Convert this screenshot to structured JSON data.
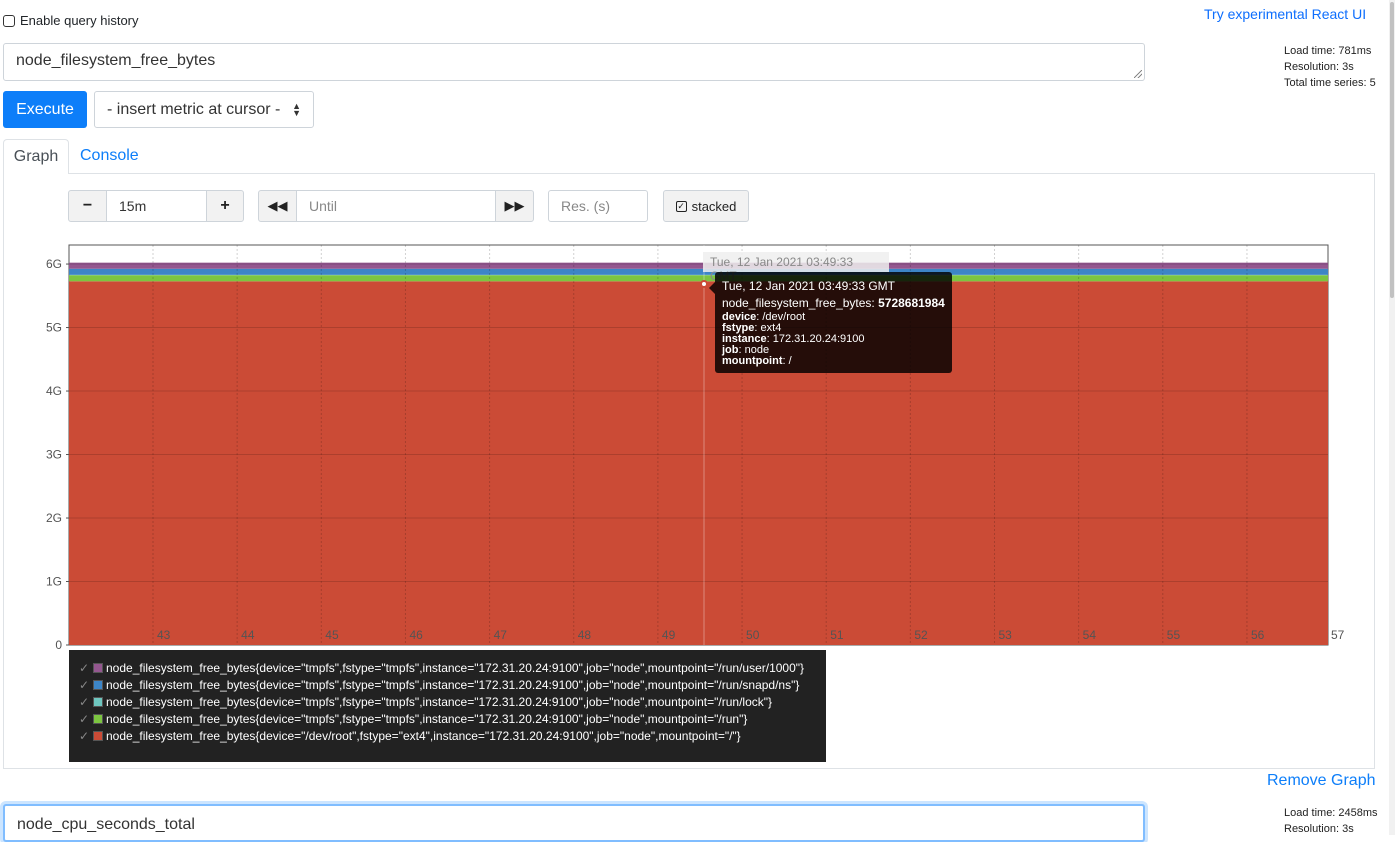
{
  "top": {
    "history_label": "Enable query history",
    "react_link": "Try experimental React UI"
  },
  "panel1": {
    "expression": "node_filesystem_free_bytes",
    "stats": {
      "load_time": "Load time: 781ms",
      "resolution": "Resolution: 3s",
      "total_series": "Total time series: 5"
    },
    "execute_label": "Execute",
    "metric_select": "- insert metric at cursor -",
    "tabs": {
      "graph": "Graph",
      "console": "Console"
    },
    "controls": {
      "minus": "−",
      "range": "15m",
      "plus": "+",
      "back": "◀◀",
      "until_placeholder": "Until",
      "forward": "▶▶",
      "res_placeholder": "Res. (s)",
      "stacked_label": "stacked"
    },
    "hover_label": "Tue, 12 Jan 2021 03:49:33 GMT",
    "tooltip": {
      "time": "Tue, 12 Jan 2021 03:49:33 GMT",
      "metric": "node_filesystem_free_bytes: ",
      "value": "5728681984",
      "labels": [
        {
          "k": "device",
          "v": ": /dev/root"
        },
        {
          "k": "fstype",
          "v": ": ext4"
        },
        {
          "k": "instance",
          "v": ": 172.31.20.24:9100"
        },
        {
          "k": "job",
          "v": ": node"
        },
        {
          "k": "mountpoint",
          "v": ": /"
        }
      ]
    },
    "legend": [
      {
        "label": "node_filesystem_free_bytes{device=\"tmpfs\",fstype=\"tmpfs\",instance=\"172.31.20.24:9100\",job=\"node\",mountpoint=\"/run/user/1000\"}",
        "color": "#94578f"
      },
      {
        "label": "node_filesystem_free_bytes{device=\"tmpfs\",fstype=\"tmpfs\",instance=\"172.31.20.24:9100\",job=\"node\",mountpoint=\"/run/snapd/ns\"}",
        "color": "#3d85c6"
      },
      {
        "label": "node_filesystem_free_bytes{device=\"tmpfs\",fstype=\"tmpfs\",instance=\"172.31.20.24:9100\",job=\"node\",mountpoint=\"/run/lock\"}",
        "color": "#6fc7c0"
      },
      {
        "label": "node_filesystem_free_bytes{device=\"tmpfs\",fstype=\"tmpfs\",instance=\"172.31.20.24:9100\",job=\"node\",mountpoint=\"/run\"}",
        "color": "#7cc540"
      },
      {
        "label": "node_filesystem_free_bytes{device=\"/dev/root\",fstype=\"ext4\",instance=\"172.31.20.24:9100\",job=\"node\",mountpoint=\"/\"}",
        "color": "#cb4b36"
      }
    ],
    "remove_graph": "Remove Graph"
  },
  "panel2": {
    "expression": "node_cpu_seconds_total",
    "stats": {
      "load_time": "Load time: 2458ms",
      "resolution": "Resolution: 3s"
    }
  },
  "chart_data": {
    "type": "area",
    "stacked": true,
    "x": [
      "43",
      "44",
      "45",
      "46",
      "47",
      "48",
      "49",
      "50",
      "51",
      "52",
      "53",
      "54",
      "55",
      "56",
      "57"
    ],
    "y_ticks": [
      "0",
      "1G",
      "2G",
      "3G",
      "4G",
      "5G",
      "6G"
    ],
    "ylim": [
      0,
      6300000000
    ],
    "grid": true,
    "series": [
      {
        "name": "node_filesystem_free_bytes{device=\"/dev/root\",fstype=\"ext4\",instance=\"172.31.20.24:9100\",job=\"node\",mountpoint=\"/\"}",
        "color": "#cb4b36",
        "value": 5728681984
      },
      {
        "name": "node_filesystem_free_bytes{device=\"tmpfs\",fstype=\"tmpfs\",instance=\"172.31.20.24:9100\",job=\"node\",mountpoint=\"/run\"}",
        "color": "#7cc540",
        "value": 96000000
      },
      {
        "name": "node_filesystem_free_bytes{device=\"tmpfs\",fstype=\"tmpfs\",instance=\"172.31.20.24:9100\",job=\"node\",mountpoint=\"/run/lock\"}",
        "color": "#6fc7c0",
        "value": 5200000
      },
      {
        "name": "node_filesystem_free_bytes{device=\"tmpfs\",fstype=\"tmpfs\",instance=\"172.31.20.24:9100\",job=\"node\",mountpoint=\"/run/snapd/ns\"}",
        "color": "#3d85c6",
        "value": 96000000
      },
      {
        "name": "node_filesystem_free_bytes{device=\"tmpfs\",fstype=\"tmpfs\",instance=\"172.31.20.24:9100\",job=\"node\",mountpoint=\"/run/user/1000\"}",
        "color": "#94578f",
        "value": 96000000
      }
    ],
    "hover_x": "Tue, 12 Jan 2021 03:49:33 GMT"
  }
}
